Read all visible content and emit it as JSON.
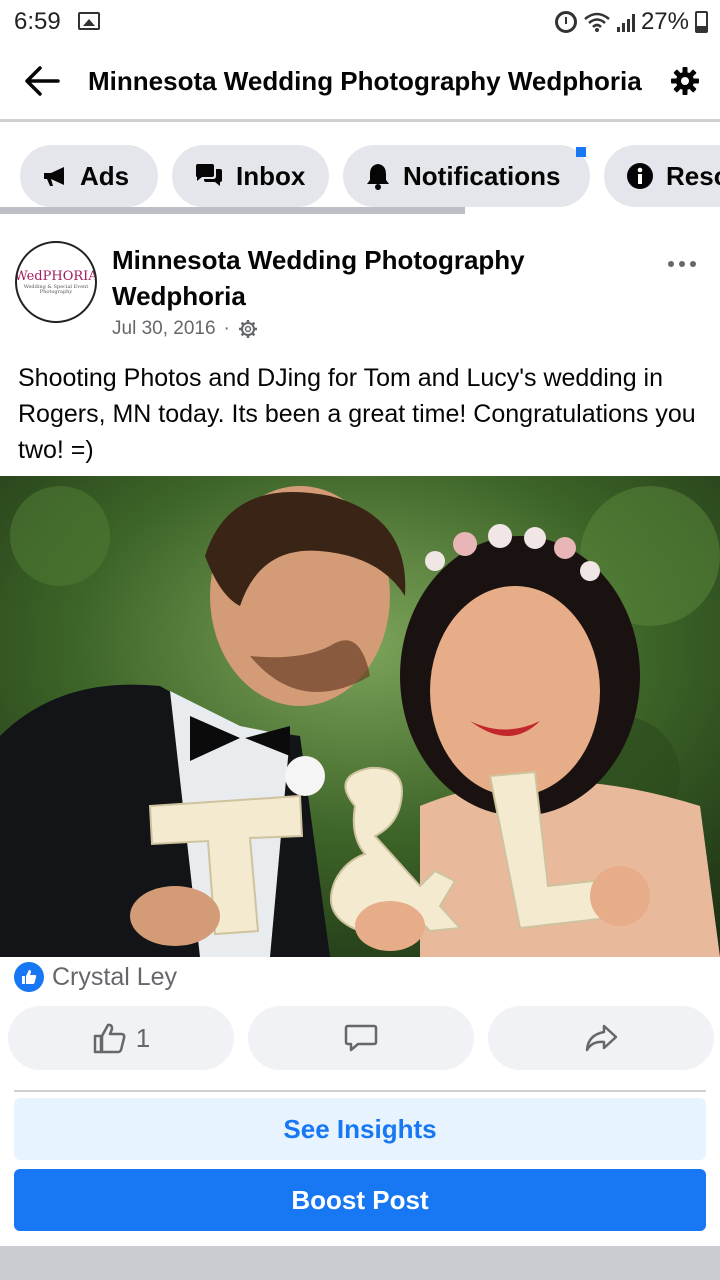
{
  "status_bar": {
    "time": "6:59",
    "battery": "27%"
  },
  "header": {
    "title": "Minnesota Wedding Photography Wedphoria",
    "back_icon": "arrow-left-icon",
    "settings_icon": "gear-icon"
  },
  "tabs": [
    {
      "label": "Ads",
      "icon": "megaphone-icon"
    },
    {
      "label": "Inbox",
      "icon": "chat-bubbles-icon"
    },
    {
      "label": "Notifications",
      "icon": "bell-icon",
      "has_unread_dot": true
    },
    {
      "label": "Resources",
      "icon": "info-icon"
    }
  ],
  "post": {
    "avatar_logo_text": "WedPHORIA",
    "avatar_logo_subtext": "Wedding & Special Event Photography",
    "author_line1": "Minnesota Wedding Photography",
    "author_line2": "Wedphoria",
    "date": "Jul 30, 2016",
    "separator": "·",
    "text": "Shooting Photos and DJing for Tom and Lucy's wedding in Rogers, MN today. Its been a great time! Congratulations you two! =)",
    "photo_letters": "T&L"
  },
  "reactions": {
    "reactor_name": "Crystal Ley",
    "like_count": "1"
  },
  "actions": {
    "see_insights": "See Insights",
    "boost_post": "Boost Post"
  },
  "colors": {
    "accent": "#1877f2",
    "tab_bg": "#e4e6eb",
    "secondary_text": "#65676b"
  }
}
